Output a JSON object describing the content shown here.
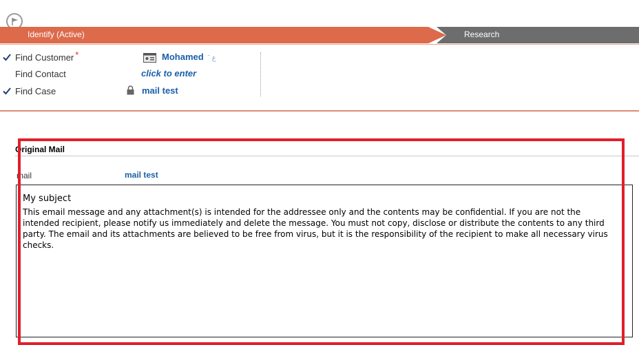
{
  "process": {
    "stages": [
      {
        "label": "Identify (Active)",
        "state": "active",
        "color": "#dc6a4b"
      },
      {
        "label": "Research",
        "state": "inactive",
        "color": "#6d6d6d"
      }
    ]
  },
  "steps": [
    {
      "label": "Find Customer",
      "required": true,
      "completed": true,
      "value": "Mohamed",
      "value_suffix": "ˉ   ع",
      "icon": "contact-card-icon"
    },
    {
      "label": "Find Contact",
      "required": false,
      "completed": false,
      "value": "click to enter",
      "icon": ""
    },
    {
      "label": "Find Case",
      "required": false,
      "completed": true,
      "value": "mail test",
      "icon": "lock-icon"
    }
  ],
  "required_marker": "*",
  "original_mail": {
    "section_title": "Original Mail",
    "field_label": "mail",
    "field_value": "mail test",
    "subject": "My subject",
    "body": "This email message and any attachment(s) is intended for the addressee only and the contents may be confidential. If you are not the intended recipient, please notify us immediately and delete the message. You must not copy, disclose or distribute the contents to any third party. The email and its attachments are believed to be free from virus, but it is the responsibility of the recipient to make all necessary virus checks."
  },
  "colors": {
    "stage_active": "#dc6a4b",
    "stage_inactive": "#6d6d6d",
    "link": "#1a5fa8",
    "highlight": "#e0202a"
  }
}
